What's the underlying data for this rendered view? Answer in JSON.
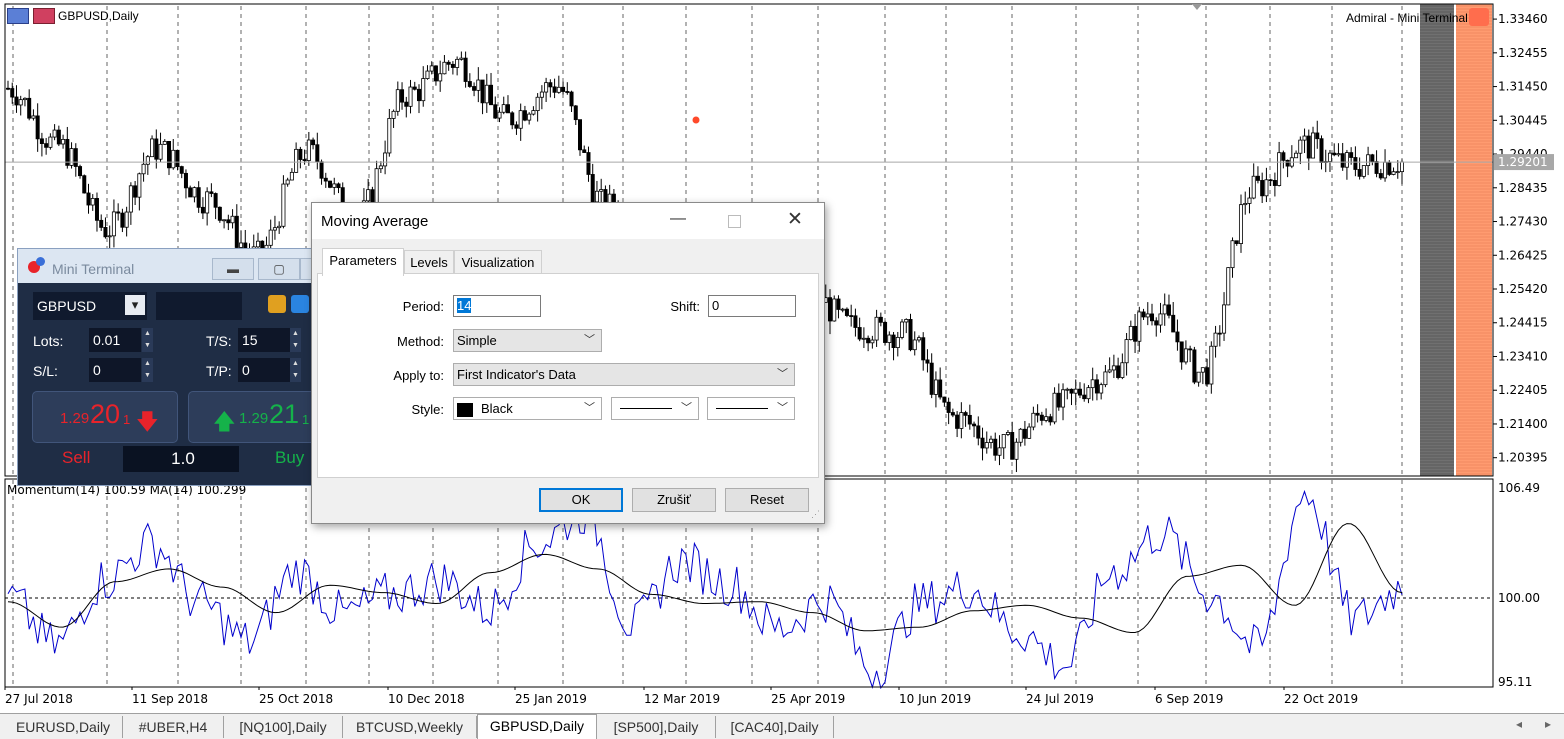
{
  "window": {
    "symbol_title": "GBPUSD,Daily",
    "broker_label": "Admiral - Mini Terminal"
  },
  "price_axis": {
    "ticks": [
      "1.33460",
      "1.32455",
      "1.31450",
      "1.30445",
      "1.29440",
      "1.28435",
      "1.27430",
      "1.26425",
      "1.25420",
      "1.24415",
      "1.23410",
      "1.22405",
      "1.21400",
      "1.20395"
    ],
    "current_price": "1.29201"
  },
  "indicator": {
    "label": "Momentum(14) 100.59 MA(14) 100.299",
    "ticks": [
      "106.49",
      "100.00",
      "95.11"
    ]
  },
  "time_axis": {
    "labels": [
      "27 Jul 2018",
      "11 Sep 2018",
      "25 Oct 2018",
      "10 Dec 2018",
      "25 Jan 2019",
      "12 Mar 2019",
      "25 Apr 2019",
      "10 Jun 2019",
      "24 Jul 2019",
      "6 Sep 2019",
      "22 Oct 2019"
    ]
  },
  "chart_data": [
    {
      "type": "candlestick",
      "title": "GBPUSD,Daily",
      "ylim": [
        1.1985,
        1.3385
      ],
      "x_labels": [
        "27 Jul 2018",
        "11 Sep 2018",
        "25 Oct 2018",
        "10 Dec 2018",
        "25 Jan 2019",
        "12 Mar 2019",
        "25 Apr 2019",
        "10 Jun 2019",
        "24 Jul 2019",
        "6 Sep 2019",
        "22 Oct 2019"
      ],
      "close_anchors": [
        1.314,
        1.297,
        1.272,
        1.296,
        1.281,
        1.264,
        1.295,
        1.275,
        1.312,
        1.322,
        1.305,
        1.315,
        1.279,
        1.268,
        1.262,
        1.252,
        1.254,
        1.243,
        1.241,
        1.216,
        1.207,
        1.219,
        1.228,
        1.248,
        1.229,
        1.284,
        1.297,
        1.291,
        1.292
      ],
      "last_price": 1.29201,
      "grid": "vertical dashed"
    },
    {
      "type": "line",
      "title": "Momentum(14) 100.59 MA(14) 100.299",
      "ylim": [
        95.11,
        106.49
      ],
      "series": [
        {
          "name": "Momentum(14)",
          "color": "#0000cc",
          "anchors": [
            100.0,
            97.4,
            101.0,
            103.0,
            99.7,
            97.6,
            101.5,
            99.1,
            100.2,
            101.0,
            99.4,
            103.0,
            104.7,
            98.5,
            102.0,
            100.8,
            98.3,
            99.9,
            96.1,
            99.7,
            100.6,
            98.2,
            96.3,
            101.5,
            103.6,
            100.2,
            97.2,
            105.8,
            98.8,
            100.59
          ]
        },
        {
          "name": "MA(14)",
          "color": "#000000",
          "anchors": [
            99.8,
            98.4,
            100.9,
            101.6,
            100.6,
            99.2,
            100.7,
            100.3,
            99.7,
            101.4,
            102.4,
            101.6,
            100.2,
            99.7,
            99.8,
            99.2,
            98.2,
            98.4,
            99.3,
            99.6,
            98.9,
            98.1,
            101.2,
            101.8,
            99.6,
            104.1,
            100.299
          ]
        }
      ],
      "reference_line": 100.0
    }
  ],
  "mini_terminal": {
    "title": "Mini Terminal",
    "symbol": "GBPUSD",
    "lots_label": "Lots:",
    "lots_value": "0.01",
    "ts_label": "T/S:",
    "ts_value": "15",
    "sl_label": "S/L:",
    "sl_value": "0",
    "tp_label": "T/P:",
    "tp_value": "0",
    "sell": {
      "prefix": "1.29",
      "big": "20",
      "small": "1",
      "label": "Sell"
    },
    "buy": {
      "prefix": "1.29",
      "big": "21",
      "small": "1",
      "label": "Buy"
    },
    "volume": "1.0"
  },
  "dialog": {
    "title": "Moving Average",
    "tabs": [
      "Parameters",
      "Levels",
      "Visualization"
    ],
    "period_label": "Period:",
    "period_value": "14",
    "shift_label": "Shift:",
    "shift_value": "0",
    "method_label": "Method:",
    "method_value": "Simple",
    "apply_label": "Apply to:",
    "apply_value": "First Indicator's Data",
    "style_label": "Style:",
    "style_color": "Black",
    "style_color_hex": "#000000",
    "ok": "OK",
    "cancel": "Zrušiť",
    "reset": "Reset"
  },
  "tabs": [
    "EURUSD,Daily",
    "#UBER,H4",
    "[NQ100],Daily",
    "BTCUSD,Weekly",
    "GBPUSD,Daily",
    "[SP500],Daily",
    "[CAC40],Daily"
  ],
  "active_tab": "GBPUSD,Daily",
  "colors": {
    "bull": "#ffffff",
    "bear": "#000000",
    "momentum": "#0000cc",
    "ma": "#000000",
    "shade_gray": "#707070",
    "shade_orange": "#ff9b70",
    "sell": "#e8232a",
    "buy": "#15b24a"
  }
}
